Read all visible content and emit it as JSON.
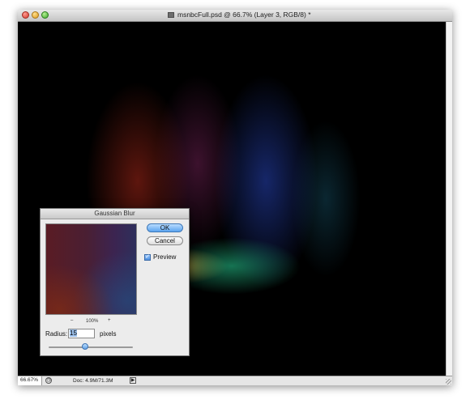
{
  "window": {
    "title": "msnbcFull.psd @ 66.7% (Layer 3, RGB/8) *"
  },
  "status_bar": {
    "zoom": "66.67%",
    "doc_size": "Doc: 4.9M/71.3M"
  },
  "dialog": {
    "title": "Gaussian Blur",
    "ok_label": "OK",
    "cancel_label": "Cancel",
    "preview_label": "Preview",
    "preview_checked": true,
    "zoom_minus": "–",
    "zoom_percent": "100%",
    "zoom_plus": "+",
    "radius_label": "Radius:",
    "radius_value": "15",
    "radius_unit": "pixels"
  },
  "colors": {
    "ok_accent": "#5ba4ef",
    "canvas_bg": "#000000"
  },
  "icons": {
    "status_icon": "clock-icon",
    "status_arrow": "play-arrow-icon",
    "doc_icon": "document-icon"
  }
}
